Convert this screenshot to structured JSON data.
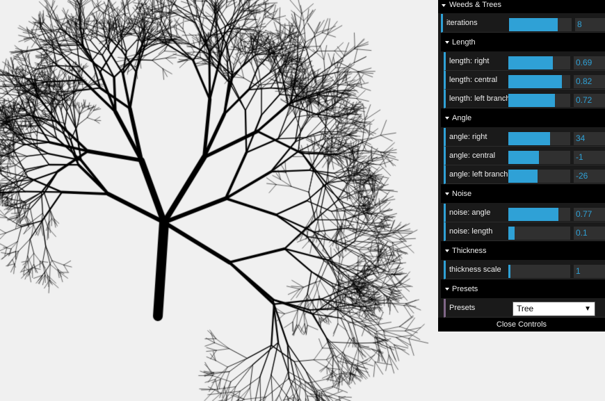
{
  "gui": {
    "root_folder": "Weeds & Trees",
    "iterations": {
      "label": "iterations",
      "value": "8",
      "fraction": 0.78
    },
    "folders": [
      {
        "title": "Length",
        "controls": [
          {
            "label": "length: right",
            "value": "0.69",
            "fraction": 0.72
          },
          {
            "label": "length: central",
            "value": "0.82",
            "fraction": 0.86
          },
          {
            "label": "length: left branch",
            "value": "0.72",
            "fraction": 0.75
          }
        ]
      },
      {
        "title": "Angle",
        "controls": [
          {
            "label": "angle: right",
            "value": "34",
            "fraction": 0.67
          },
          {
            "label": "angle: central",
            "value": "-1",
            "fraction": 0.49
          },
          {
            "label": "angle: left branch",
            "value": "-26",
            "fraction": 0.47
          }
        ]
      },
      {
        "title": "Noise",
        "controls": [
          {
            "label": "noise: angle",
            "value": "0.77",
            "fraction": 0.81
          },
          {
            "label": "noise: length",
            "value": "0.1",
            "fraction": 0.1
          }
        ]
      },
      {
        "title": "Thickness",
        "controls": [
          {
            "label": "thickness scale",
            "value": "1",
            "fraction": 0.03
          }
        ]
      },
      {
        "title": "Presets",
        "controls": []
      }
    ],
    "presets": {
      "label": "Presets",
      "selected": "Tree"
    },
    "close_label": "Close Controls",
    "accent_color": "#2fa1d6"
  }
}
